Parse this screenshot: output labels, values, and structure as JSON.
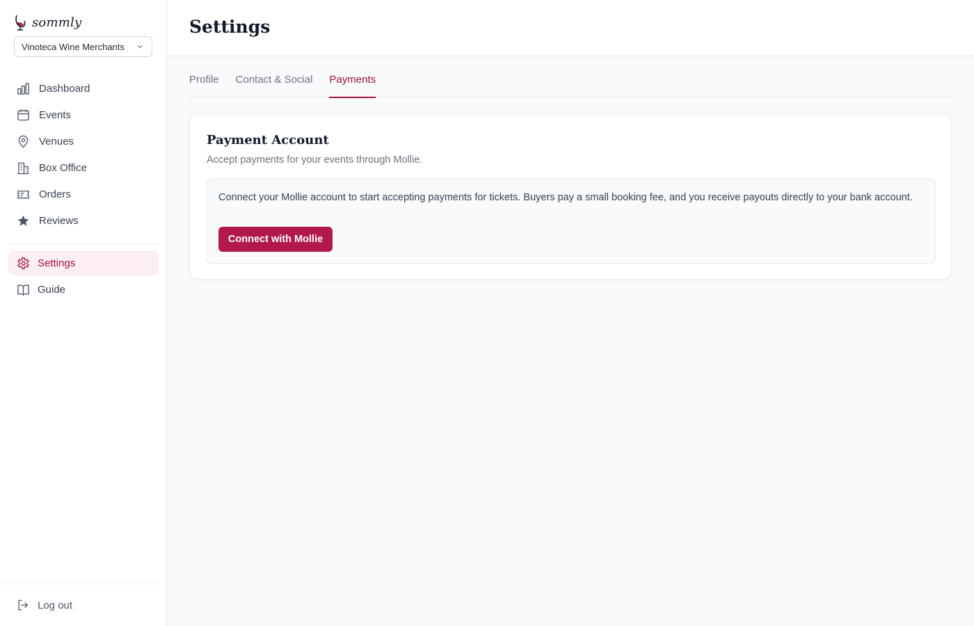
{
  "brand": {
    "name": "sommly",
    "accent": "#9f1239",
    "button": "#b0194a"
  },
  "org_selector": {
    "value": "Vinoteca Wine Merchants"
  },
  "sidebar": {
    "items": [
      {
        "label": "Dashboard",
        "icon": "bar-chart-icon"
      },
      {
        "label": "Events",
        "icon": "calendar-icon"
      },
      {
        "label": "Venues",
        "icon": "map-pin-icon"
      },
      {
        "label": "Box Office",
        "icon": "building-icon"
      },
      {
        "label": "Orders",
        "icon": "ticket-icon"
      },
      {
        "label": "Reviews",
        "icon": "star-icon"
      }
    ],
    "secondary": [
      {
        "label": "Settings",
        "icon": "gear-icon",
        "active": true
      },
      {
        "label": "Guide",
        "icon": "book-icon"
      }
    ],
    "logout": "Log out"
  },
  "header": {
    "title": "Settings"
  },
  "tabs": [
    {
      "label": "Profile"
    },
    {
      "label": "Contact & Social"
    },
    {
      "label": "Payments",
      "active": true
    }
  ],
  "payment_card": {
    "title": "Payment Account",
    "subtitle": "Accept payments for your events through Mollie.",
    "info": "Connect your Mollie account to start accepting payments for tickets. Buyers pay a small booking fee, and you receive payouts directly to your bank account.",
    "button": "Connect with Mollie"
  }
}
